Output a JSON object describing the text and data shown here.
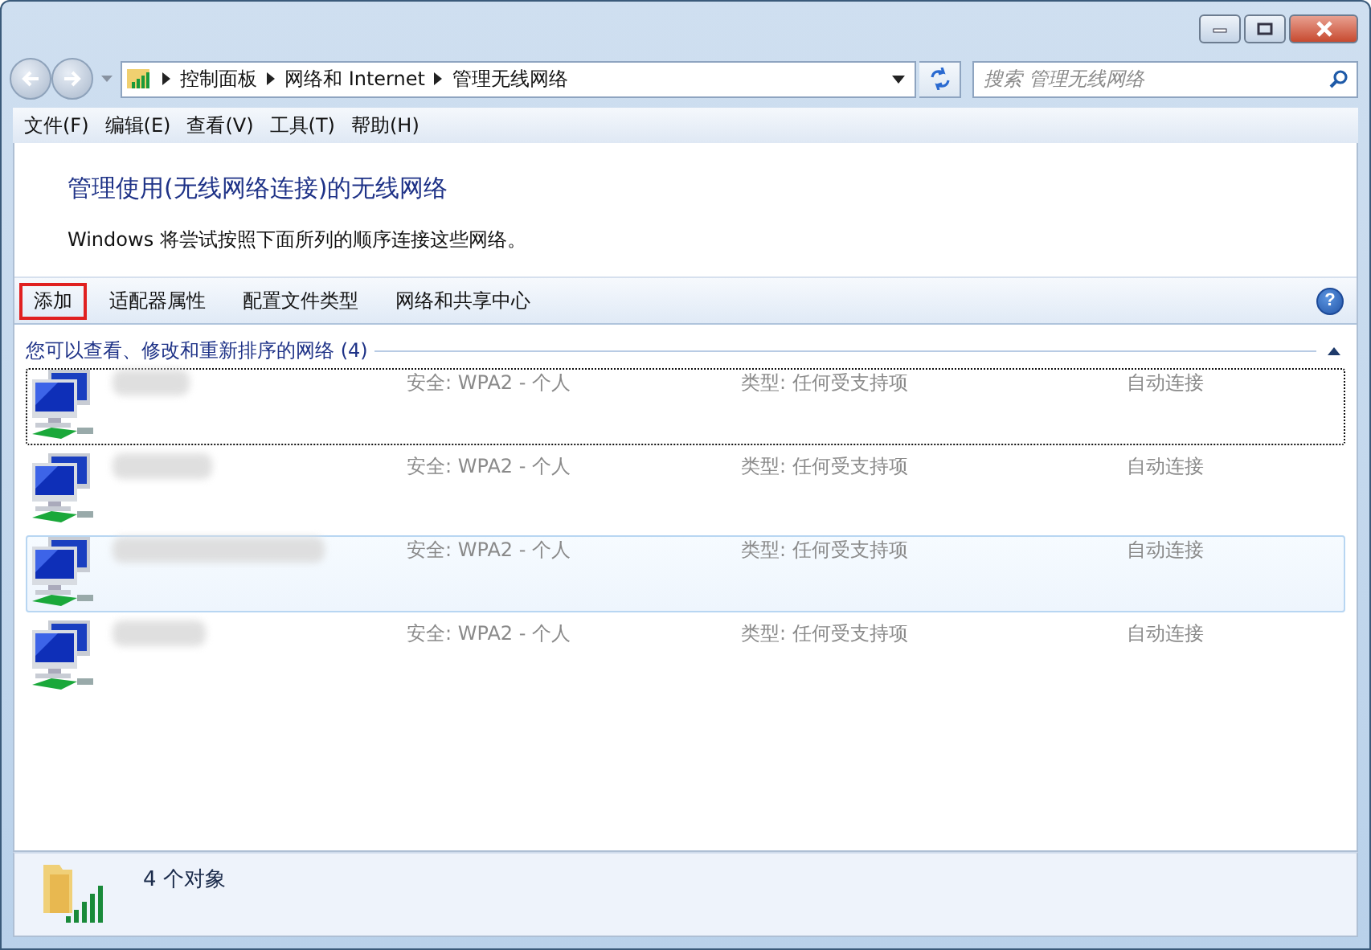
{
  "help": {
    "label": "?"
  },
  "address_bar": {
    "crumbs": [
      "控制面板",
      "网络和 Internet",
      "管理无线网络"
    ]
  },
  "search": {
    "placeholder": "搜索 管理无线网络"
  },
  "menu": [
    "文件(F)",
    "编辑(E)",
    "查看(V)",
    "工具(T)",
    "帮助(H)"
  ],
  "header": {
    "title": "管理使用(无线网络连接)的无线网络",
    "description": "Windows 将尝试按照下面所列的顺序连接这些网络。"
  },
  "toolbar": [
    {
      "label": "添加",
      "highlighted": true
    },
    {
      "label": "适配器属性",
      "highlighted": false
    },
    {
      "label": "配置文件类型",
      "highlighted": false
    },
    {
      "label": "网络和共享中心",
      "highlighted": false
    }
  ],
  "group": {
    "title": "您可以查看、修改和重新排序的网络 (4)",
    "expanded": true
  },
  "networks": [
    {
      "security": "安全: WPA2 - 个人",
      "type": "类型: 任何受支持项",
      "mode": "自动连接",
      "focused": true,
      "selected": false
    },
    {
      "security": "安全: WPA2 - 个人",
      "type": "类型: 任何受支持项",
      "mode": "自动连接",
      "focused": false,
      "selected": false
    },
    {
      "security": "安全: WPA2 - 个人",
      "type": "类型: 任何受支持项",
      "mode": "自动连接",
      "focused": false,
      "selected": true
    },
    {
      "security": "安全: WPA2 - 个人",
      "type": "类型: 任何受支持项",
      "mode": "自动连接",
      "focused": false,
      "selected": false
    }
  ],
  "status_bar": {
    "text": "4 个对象"
  }
}
